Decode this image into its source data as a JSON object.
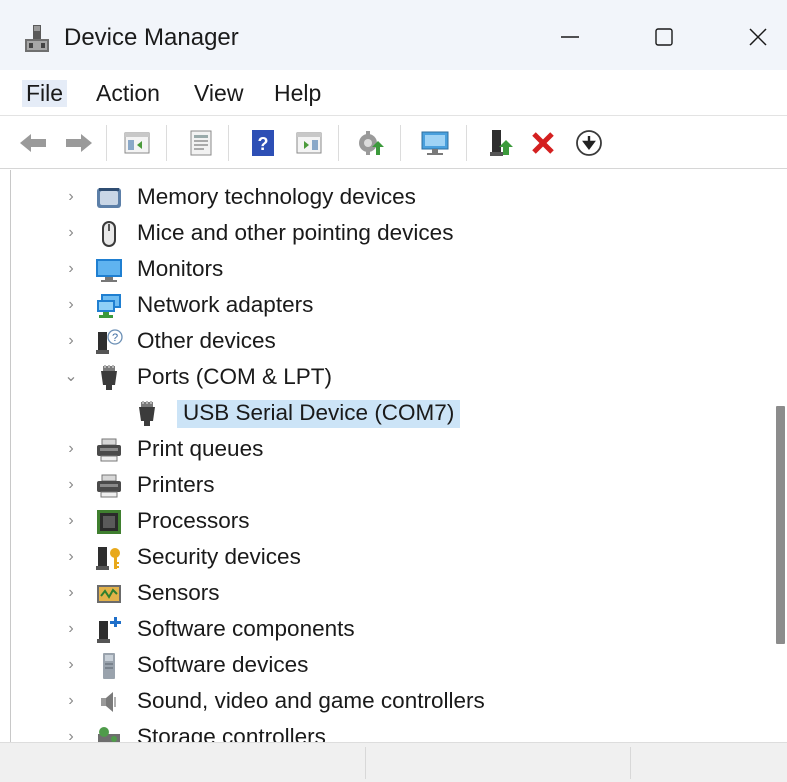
{
  "window": {
    "title": "Device Manager",
    "minimize_glyph": "—",
    "maximize_glyph": "☐",
    "close_glyph": "✕"
  },
  "menu": {
    "items": [
      {
        "label": "File"
      },
      {
        "label": "Action"
      },
      {
        "label": "View"
      },
      {
        "label": "Help"
      }
    ]
  },
  "toolbar": {
    "buttons": [
      "back-icon",
      "forward-icon",
      "show-hide-tree-icon",
      "properties-icon",
      "help-icon",
      "action-pane-icon",
      "update-driver-icon",
      "scan-hardware-icon",
      "add-driver-icon",
      "uninstall-device-icon",
      "disable-device-icon"
    ]
  },
  "tree": {
    "items": [
      {
        "label": "Memory technology devices",
        "expanded": false,
        "icon": "memory-card-icon"
      },
      {
        "label": "Mice and other pointing devices",
        "expanded": false,
        "icon": "mouse-icon"
      },
      {
        "label": "Monitors",
        "expanded": false,
        "icon": "monitor-icon"
      },
      {
        "label": "Network adapters",
        "expanded": false,
        "icon": "network-adapter-icon"
      },
      {
        "label": "Other devices",
        "expanded": false,
        "icon": "unknown-device-icon"
      },
      {
        "label": "Ports (COM & LPT)",
        "expanded": true,
        "icon": "port-icon"
      },
      {
        "label": "USB Serial Device (COM7)",
        "child": true,
        "selected": true,
        "icon": "port-icon"
      },
      {
        "label": "Print queues",
        "expanded": false,
        "icon": "print-queue-icon"
      },
      {
        "label": "Printers",
        "expanded": false,
        "icon": "printer-icon"
      },
      {
        "label": "Processors",
        "expanded": false,
        "icon": "processor-icon"
      },
      {
        "label": "Security devices",
        "expanded": false,
        "icon": "security-device-icon"
      },
      {
        "label": "Sensors",
        "expanded": false,
        "icon": "sensor-icon"
      },
      {
        "label": "Software components",
        "expanded": false,
        "icon": "software-component-icon"
      },
      {
        "label": "Software devices",
        "expanded": false,
        "icon": "software-device-icon"
      },
      {
        "label": "Sound, video and game controllers",
        "expanded": false,
        "icon": "speaker-icon"
      },
      {
        "label": "Storage controllers",
        "expanded": false,
        "icon": "storage-controller-icon"
      }
    ]
  },
  "colors": {
    "selection": "#cce4f7",
    "titlebar": "#f2f5fa",
    "menu_active": "#e5ecf7"
  }
}
